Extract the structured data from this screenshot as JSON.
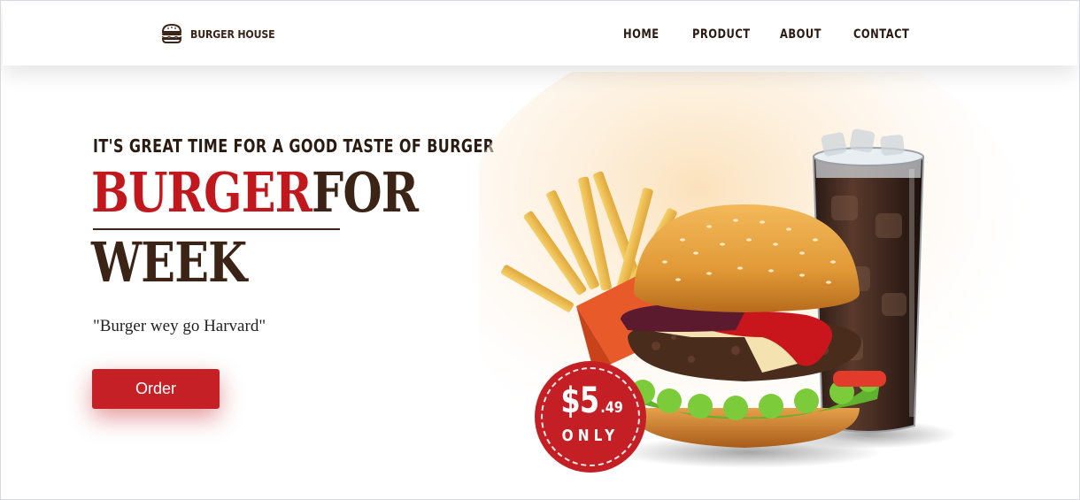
{
  "header": {
    "logo": {
      "icon": "burger-icon",
      "text": "BURGER HOUSE"
    },
    "nav": [
      {
        "label": "HOME"
      },
      {
        "label": "PRODUCT"
      },
      {
        "label": "ABOUT"
      },
      {
        "label": "CONTACT"
      }
    ]
  },
  "hero": {
    "tagline": "IT'S GREAT TIME FOR A GOOD TASTE OF BURGER",
    "headline_red": "BURGER",
    "headline_brown": "FOR",
    "headline_line2": "WEEK",
    "quote": "\"Burger wey go Harvard\"",
    "order_label": "Order",
    "price": {
      "dollars": "$5",
      "cents": ".49",
      "only": "ONLY"
    },
    "image": {
      "icon": "burger-fries-drink-image"
    }
  },
  "colors": {
    "accent_red": "#c52026",
    "brown": "#3b2416",
    "text_dark": "#2a1a12"
  }
}
